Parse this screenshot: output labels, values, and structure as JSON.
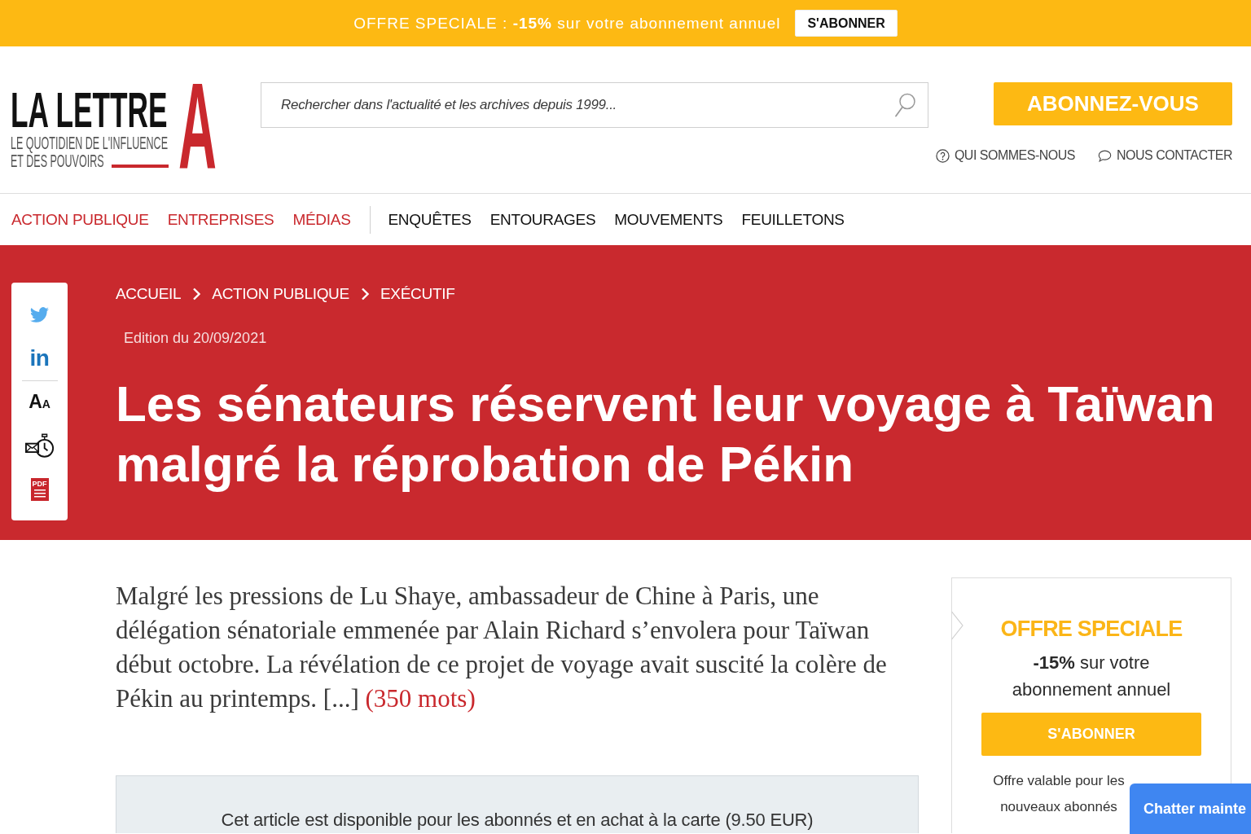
{
  "promo_bar": {
    "text": "OFFRE SPECIALE : **-15%** sur votre abonnement annuel",
    "button": "S'ABONNER"
  },
  "header": {
    "logo": {
      "name": "LA LETTRE",
      "tagline": [
        "LE QUOTIDIEN DE L'INFLUENCE",
        "ET DES POUVOIRS"
      ],
      "letter": "A"
    },
    "search": {
      "placeholder": "Rechercher dans l'actualité et les archives depuis 1999..."
    },
    "subscribe_button": "ABONNEZ-VOUS",
    "links": [
      {
        "kind": "about",
        "label": "QUI SOMMES-NOUS"
      },
      {
        "kind": "contact",
        "label": "NOUS CONTACTER"
      }
    ]
  },
  "nav": {
    "sections": [
      "ACTION PUBLIQUE",
      "ENTREPRISES",
      "MÉDIAS"
    ],
    "categories": [
      "ENQUÊTES",
      "ENTOURAGES",
      "MOUVEMENTS",
      "FEUILLETONS"
    ]
  },
  "article": {
    "share_bar": {
      "share": [
        {
          "kind": "twitter"
        },
        {
          "kind": "linkedin",
          "label": "in"
        }
      ],
      "tools": [
        {
          "kind": "font-size",
          "label": "A$_{A}$"
        },
        {
          "kind": "email-later"
        },
        {
          "kind": "pdf",
          "label": "PDF"
        }
      ]
    },
    "breadcrumb": [
      "ACCUEIL",
      "ACTION PUBLIQUE",
      "EXÉCUTIF"
    ],
    "edition": "Edition du 20/09/2021",
    "title": "Les sénateurs réservent leur voyage à Taïwan malgré la réprobation de Pékin",
    "lead": "Malgré les pressions de Lu Shaye, ambassadeur de Chine à Paris, une délégation sénatoriale emmenée par Alain Richard s’envolera pour Taïwan début octobre. La révélation de ce projet de voyage avait suscité la colère de Pékin au printemps. [...]",
    "more_link": "(350 mots)",
    "paywall_notice": "Cet article est disponible pour les abonnés et en achat à la carte (9.50 EUR)"
  },
  "offer_card": {
    "title": "OFFRE SPECIALE",
    "text": "**-15%** sur votre abonnement annuel",
    "button": "S'ABONNER",
    "note": "Offre valable pour les nouveaux abonnés"
  },
  "chat_button": "Chatter mainte"
}
